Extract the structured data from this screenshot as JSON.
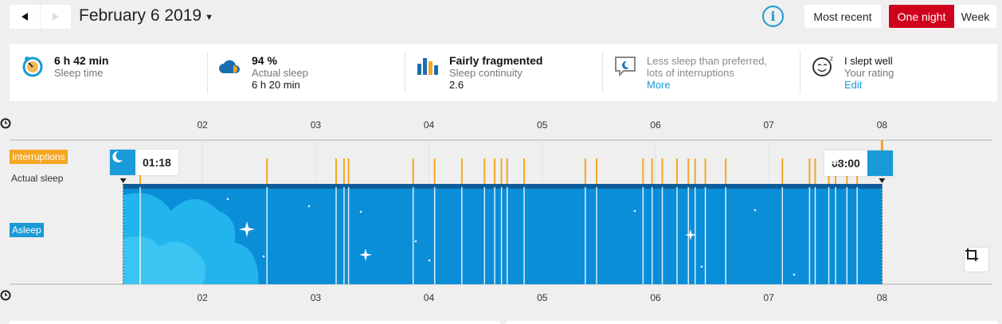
{
  "nav": {
    "date": "February 6 2019",
    "view_options": {
      "most_recent": "Most recent",
      "one_night": "One night",
      "week": "Week"
    },
    "info_label": "i"
  },
  "summary": [
    {
      "icon": "clock-moon-icon",
      "value": "6 h 42 min",
      "label": "Sleep time",
      "sub": ""
    },
    {
      "icon": "cloud-pie-icon",
      "value": "94 %",
      "label": "Actual sleep",
      "sub": "6 h 20 min"
    },
    {
      "icon": "bars-icon",
      "value": "Fairly fragmented",
      "label": "Sleep continuity",
      "sub": "2.6"
    },
    {
      "icon": "speech-moon-icon",
      "value": "",
      "label": "Less sleep than preferred, lots of interruptions",
      "line1": "Less sleep than preferred,",
      "line2": "lots of interruptions",
      "link": "More"
    },
    {
      "icon": "smiley-icon",
      "value": "I slept well",
      "label": "Your rating",
      "link": "Edit"
    }
  ],
  "timeline": {
    "hour_ticks": [
      "02",
      "03",
      "04",
      "05",
      "06",
      "07",
      "08"
    ],
    "row_labels": {
      "interruptions": "Interruptions",
      "actual_sleep": "Actual sleep",
      "asleep": "Asleep"
    },
    "start_time": "01:18",
    "end_time": "08:00",
    "axis_start_hour": 1.0,
    "axis_end_hour": 8.0,
    "interruptions_hours": [
      1.45,
      2.57,
      3.18,
      3.25,
      3.29,
      3.86,
      4.05,
      4.29,
      4.49,
      4.58,
      4.64,
      4.69,
      4.84,
      5.38,
      5.48,
      5.89,
      5.97,
      6.06,
      6.19,
      6.29,
      6.35,
      6.44,
      6.62,
      7.12,
      7.36,
      7.41,
      7.53,
      7.59,
      7.69,
      7.78
    ],
    "colors": {
      "asleep": "#0a8ed8",
      "interruption": "#f5a623",
      "actual": "#0f5e9c",
      "brand_red": "#d0021b",
      "accent_blue": "#1a9ad6"
    }
  }
}
